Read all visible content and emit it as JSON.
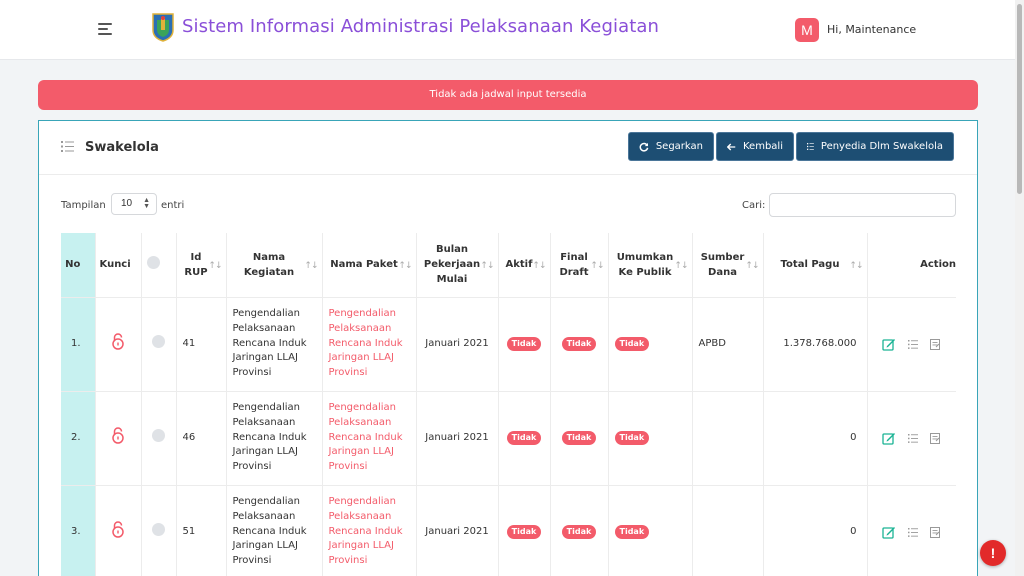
{
  "header": {
    "app_title": "Sistem Informasi Administrasi Pelaksanaan Kegiatan",
    "avatar_letter": "M",
    "greeting": "Hi, Maintenance"
  },
  "alert": {
    "message": "Tidak ada jadwal input tersedia"
  },
  "card": {
    "title": "Swakelola",
    "buttons": {
      "refresh": "Segarkan",
      "back": "Kembali",
      "provider": "Penyedia Dlm Swakelola"
    }
  },
  "table_controls": {
    "show_label": "Tampilan",
    "show_value": "10",
    "entries_label": "entri",
    "search_label": "Cari:"
  },
  "table": {
    "columns": [
      "No",
      "Kunci",
      "",
      "Id RUP",
      "Nama Kegiatan",
      "Nama Paket",
      "Bulan Pekerjaan Mulai",
      "Aktif",
      "Final Draft",
      "Umumkan Ke Publik",
      "Sumber Dana",
      "Total Pagu",
      "Action"
    ],
    "rows": [
      {
        "no": "1.",
        "id_rup": "41",
        "nama_kegiatan": "Pengendalian Pelaksanaan Rencana Induk Jaringan LLAJ Provinsi",
        "nama_paket": "Pengendalian Pelaksanaan Rencana Induk Jaringan LLAJ Provinsi",
        "bulan": "Januari 2021",
        "aktif": "Tidak",
        "final_draft": "Tidak",
        "umumkan": "Tidak",
        "sumber_dana": "APBD",
        "total_pagu": "1.378.768.000"
      },
      {
        "no": "2.",
        "id_rup": "46",
        "nama_kegiatan": "Pengendalian Pelaksanaan Rencana Induk Jaringan LLAJ Provinsi",
        "nama_paket": "Pengendalian Pelaksanaan Rencana Induk Jaringan LLAJ Provinsi",
        "bulan": "Januari 2021",
        "aktif": "Tidak",
        "final_draft": "Tidak",
        "umumkan": "Tidak",
        "sumber_dana": "",
        "total_pagu": "0"
      },
      {
        "no": "3.",
        "id_rup": "51",
        "nama_kegiatan": "Pengendalian Pelaksanaan Rencana Induk Jaringan LLAJ Provinsi",
        "nama_paket": "Pengendalian Pelaksanaan Rencana Induk Jaringan LLAJ Provinsi",
        "bulan": "Januari 2021",
        "aktif": "Tidak",
        "final_draft": "Tidak",
        "umumkan": "Tidak",
        "sumber_dana": "",
        "total_pagu": "0"
      }
    ]
  },
  "icons": {
    "menu": "hamburger-icon",
    "lock": "unlock-icon",
    "edit": "edit-icon",
    "list": "list-icon",
    "doc": "document-icon"
  },
  "colors": {
    "accent": "#8a4fd8",
    "danger": "#f35b6a",
    "primary_button": "#1d4e73",
    "no_column": "#c7f1f0",
    "card_border": "#39a5b8",
    "edit_icon": "#1ab394"
  },
  "alert_bubble": "!"
}
